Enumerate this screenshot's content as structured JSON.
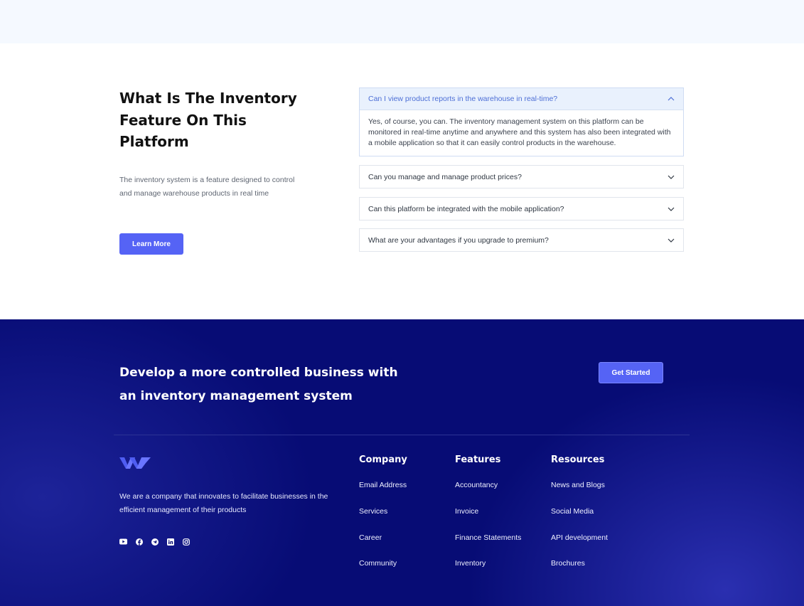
{
  "faq": {
    "title": "What Is The Inventory Feature On This Platform",
    "description": "The inventory system is a feature designed to control and manage warehouse products in real time",
    "learn_more_label": "Learn More",
    "items": [
      {
        "question": "Can I view product reports in the warehouse in real-time?",
        "answer": "Yes, of course, you can. The inventory management system on this platform can be monitored in real-time anytime and anywhere and this system has also been integrated with a mobile application so that it can easily control products in the warehouse.",
        "expanded": true
      },
      {
        "question": "Can you manage and manage product prices?",
        "expanded": false
      },
      {
        "question": "Can this platform be integrated with the mobile application?",
        "expanded": false
      },
      {
        "question": "What are your advantages if you upgrade to premium?",
        "expanded": false
      }
    ]
  },
  "cta": {
    "text": "Develop a more controlled business with an inventory management system",
    "button_label": "Get Started"
  },
  "footer": {
    "about": "We are a company that innovates to facilitate businesses in the efficient management of their products",
    "socials": [
      "youtube-icon",
      "facebook-icon",
      "telegram-icon",
      "linkedin-icon",
      "instagram-icon"
    ],
    "columns": [
      {
        "title": "Company",
        "links": [
          "Email Address",
          "Services",
          "Career",
          "Community"
        ]
      },
      {
        "title": "Features",
        "links": [
          "Accountancy",
          "Invoice",
          "Finance Statements",
          "Inventory"
        ]
      },
      {
        "title": "Resources",
        "links": [
          "News and Blogs",
          "Social Media",
          "API development",
          "Brochures"
        ]
      }
    ]
  },
  "colors": {
    "accent": "#5563F5",
    "footer_bg": "#070C75",
    "faq_open_bg": "#E9F1FD",
    "faq_open_text": "#4D6FD6"
  }
}
